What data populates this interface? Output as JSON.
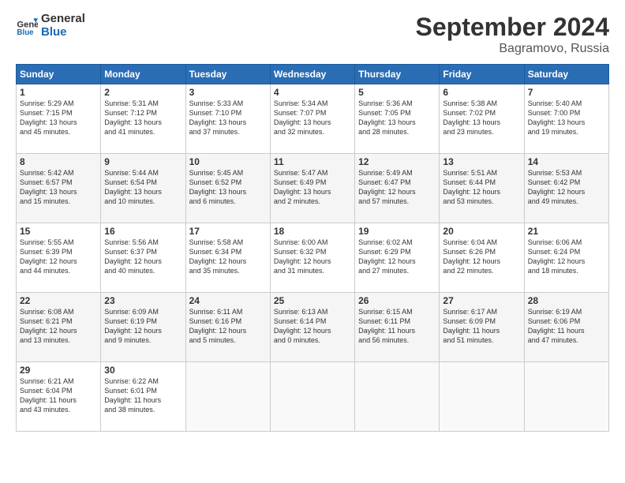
{
  "header": {
    "logo_line1": "General",
    "logo_line2": "Blue",
    "month": "September 2024",
    "location": "Bagramovo, Russia"
  },
  "days_of_week": [
    "Sunday",
    "Monday",
    "Tuesday",
    "Wednesday",
    "Thursday",
    "Friday",
    "Saturday"
  ],
  "weeks": [
    [
      {
        "day": "1",
        "lines": [
          "Sunrise: 5:29 AM",
          "Sunset: 7:15 PM",
          "Daylight: 13 hours",
          "and 45 minutes."
        ]
      },
      {
        "day": "2",
        "lines": [
          "Sunrise: 5:31 AM",
          "Sunset: 7:12 PM",
          "Daylight: 13 hours",
          "and 41 minutes."
        ]
      },
      {
        "day": "3",
        "lines": [
          "Sunrise: 5:33 AM",
          "Sunset: 7:10 PM",
          "Daylight: 13 hours",
          "and 37 minutes."
        ]
      },
      {
        "day": "4",
        "lines": [
          "Sunrise: 5:34 AM",
          "Sunset: 7:07 PM",
          "Daylight: 13 hours",
          "and 32 minutes."
        ]
      },
      {
        "day": "5",
        "lines": [
          "Sunrise: 5:36 AM",
          "Sunset: 7:05 PM",
          "Daylight: 13 hours",
          "and 28 minutes."
        ]
      },
      {
        "day": "6",
        "lines": [
          "Sunrise: 5:38 AM",
          "Sunset: 7:02 PM",
          "Daylight: 13 hours",
          "and 23 minutes."
        ]
      },
      {
        "day": "7",
        "lines": [
          "Sunrise: 5:40 AM",
          "Sunset: 7:00 PM",
          "Daylight: 13 hours",
          "and 19 minutes."
        ]
      }
    ],
    [
      {
        "day": "8",
        "lines": [
          "Sunrise: 5:42 AM",
          "Sunset: 6:57 PM",
          "Daylight: 13 hours",
          "and 15 minutes."
        ]
      },
      {
        "day": "9",
        "lines": [
          "Sunrise: 5:44 AM",
          "Sunset: 6:54 PM",
          "Daylight: 13 hours",
          "and 10 minutes."
        ]
      },
      {
        "day": "10",
        "lines": [
          "Sunrise: 5:45 AM",
          "Sunset: 6:52 PM",
          "Daylight: 13 hours",
          "and 6 minutes."
        ]
      },
      {
        "day": "11",
        "lines": [
          "Sunrise: 5:47 AM",
          "Sunset: 6:49 PM",
          "Daylight: 13 hours",
          "and 2 minutes."
        ]
      },
      {
        "day": "12",
        "lines": [
          "Sunrise: 5:49 AM",
          "Sunset: 6:47 PM",
          "Daylight: 12 hours",
          "and 57 minutes."
        ]
      },
      {
        "day": "13",
        "lines": [
          "Sunrise: 5:51 AM",
          "Sunset: 6:44 PM",
          "Daylight: 12 hours",
          "and 53 minutes."
        ]
      },
      {
        "day": "14",
        "lines": [
          "Sunrise: 5:53 AM",
          "Sunset: 6:42 PM",
          "Daylight: 12 hours",
          "and 49 minutes."
        ]
      }
    ],
    [
      {
        "day": "15",
        "lines": [
          "Sunrise: 5:55 AM",
          "Sunset: 6:39 PM",
          "Daylight: 12 hours",
          "and 44 minutes."
        ]
      },
      {
        "day": "16",
        "lines": [
          "Sunrise: 5:56 AM",
          "Sunset: 6:37 PM",
          "Daylight: 12 hours",
          "and 40 minutes."
        ]
      },
      {
        "day": "17",
        "lines": [
          "Sunrise: 5:58 AM",
          "Sunset: 6:34 PM",
          "Daylight: 12 hours",
          "and 35 minutes."
        ]
      },
      {
        "day": "18",
        "lines": [
          "Sunrise: 6:00 AM",
          "Sunset: 6:32 PM",
          "Daylight: 12 hours",
          "and 31 minutes."
        ]
      },
      {
        "day": "19",
        "lines": [
          "Sunrise: 6:02 AM",
          "Sunset: 6:29 PM",
          "Daylight: 12 hours",
          "and 27 minutes."
        ]
      },
      {
        "day": "20",
        "lines": [
          "Sunrise: 6:04 AM",
          "Sunset: 6:26 PM",
          "Daylight: 12 hours",
          "and 22 minutes."
        ]
      },
      {
        "day": "21",
        "lines": [
          "Sunrise: 6:06 AM",
          "Sunset: 6:24 PM",
          "Daylight: 12 hours",
          "and 18 minutes."
        ]
      }
    ],
    [
      {
        "day": "22",
        "lines": [
          "Sunrise: 6:08 AM",
          "Sunset: 6:21 PM",
          "Daylight: 12 hours",
          "and 13 minutes."
        ]
      },
      {
        "day": "23",
        "lines": [
          "Sunrise: 6:09 AM",
          "Sunset: 6:19 PM",
          "Daylight: 12 hours",
          "and 9 minutes."
        ]
      },
      {
        "day": "24",
        "lines": [
          "Sunrise: 6:11 AM",
          "Sunset: 6:16 PM",
          "Daylight: 12 hours",
          "and 5 minutes."
        ]
      },
      {
        "day": "25",
        "lines": [
          "Sunrise: 6:13 AM",
          "Sunset: 6:14 PM",
          "Daylight: 12 hours",
          "and 0 minutes."
        ]
      },
      {
        "day": "26",
        "lines": [
          "Sunrise: 6:15 AM",
          "Sunset: 6:11 PM",
          "Daylight: 11 hours",
          "and 56 minutes."
        ]
      },
      {
        "day": "27",
        "lines": [
          "Sunrise: 6:17 AM",
          "Sunset: 6:09 PM",
          "Daylight: 11 hours",
          "and 51 minutes."
        ]
      },
      {
        "day": "28",
        "lines": [
          "Sunrise: 6:19 AM",
          "Sunset: 6:06 PM",
          "Daylight: 11 hours",
          "and 47 minutes."
        ]
      }
    ],
    [
      {
        "day": "29",
        "lines": [
          "Sunrise: 6:21 AM",
          "Sunset: 6:04 PM",
          "Daylight: 11 hours",
          "and 43 minutes."
        ]
      },
      {
        "day": "30",
        "lines": [
          "Sunrise: 6:22 AM",
          "Sunset: 6:01 PM",
          "Daylight: 11 hours",
          "and 38 minutes."
        ]
      },
      {
        "day": "",
        "lines": []
      },
      {
        "day": "",
        "lines": []
      },
      {
        "day": "",
        "lines": []
      },
      {
        "day": "",
        "lines": []
      },
      {
        "day": "",
        "lines": []
      }
    ]
  ]
}
